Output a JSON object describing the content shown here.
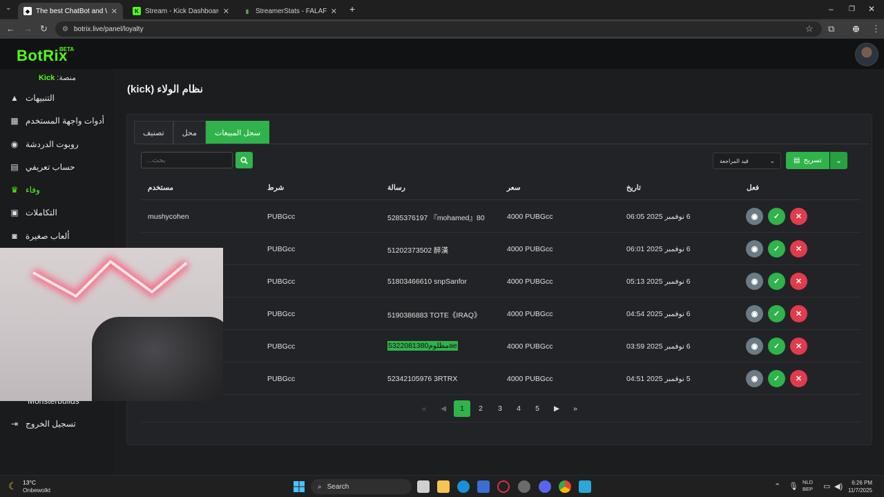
{
  "browser": {
    "tabs": [
      {
        "title": "The best ChatBot and Widgets",
        "active": true
      },
      {
        "title": "Stream - Kick Dashboard",
        "active": false
      },
      {
        "title": "StreamerStats - FALAFELCO Pro",
        "active": false
      }
    ],
    "url": "botrix.live/panel/loyalty"
  },
  "app": {
    "logo": "BotRix",
    "logo_badge": "BETA",
    "platform_label": "منصة:",
    "platform_value": "Kick",
    "accent": "#53fc18"
  },
  "sidebar": {
    "items": [
      {
        "label": "التنبيهات",
        "icon": "warning-icon",
        "active": false
      },
      {
        "label": "أدوات واجهة المستخدم",
        "icon": "widgets-icon",
        "active": false
      },
      {
        "label": "روبوت الدردشة",
        "icon": "robot-icon",
        "active": false
      },
      {
        "label": "حساب تعريفي",
        "icon": "id-card-icon",
        "active": false
      },
      {
        "label": "وفاء",
        "icon": "trophy-icon",
        "active": true
      },
      {
        "label": "التكاملات",
        "icon": "integrations-icon",
        "active": false
      },
      {
        "label": "ألعاب صغيرة",
        "icon": "gamepad-icon",
        "active": false
      }
    ],
    "hidden_item": "Monsterbuilds",
    "logout_label": "تسجيل الخروج"
  },
  "page": {
    "title": "نظام الولاء (kick)",
    "tabs": [
      "تصنيف",
      "محل",
      "سجل المبيعات"
    ],
    "active_tab": "سجل المبيعات",
    "search_placeholder": "بحث...",
    "filter_label": "قيد المراجعة",
    "export_label": "تسريح"
  },
  "table": {
    "headers": {
      "user": "مستخدم",
      "condition": "شرط",
      "message": "رسالة",
      "price": "سعر",
      "date": "تاريخ",
      "action": "فعل"
    },
    "rows": [
      {
        "user": "mushycohen",
        "condition": "PUBGcc",
        "message": "5285376197 『mohamed』80",
        "price": "4000 PUBGcc",
        "date": "6 نوفمبر 2025 06:05"
      },
      {
        "user": "",
        "condition": "PUBGcc",
        "message": "51202373502 醉漢",
        "price": "4000 PUBGcc",
        "date": "6 نوفمبر 2025 06:01"
      },
      {
        "user": "",
        "condition": "PUBGcc",
        "message": "51803466610 snpSanfor",
        "price": "4000 PUBGcc",
        "date": "6 نوفمبر 2025 05:13"
      },
      {
        "user": "",
        "condition": "PUBGcc",
        "message": "5190386883 TOTE《IRAQ》",
        "price": "4000 PUBGcc",
        "date": "6 نوفمبر 2025 04:54"
      },
      {
        "user": "",
        "condition": "PUBGcc",
        "message": "5322081380مظلومae",
        "price": "4000 PUBGcc",
        "date": "6 نوفمبر 2025 03:59",
        "highlighted": true
      },
      {
        "user": "",
        "condition": "PUBGcc",
        "message": "52342105976 3RTRX",
        "price": "4000 PUBGcc",
        "date": "5 نوفمبر 2025 04:51"
      }
    ]
  },
  "pagination": {
    "pages": [
      "1",
      "2",
      "3",
      "4",
      "5"
    ],
    "current": "1"
  },
  "taskbar": {
    "weather_temp": "13°C",
    "weather_cond": "Onbewolkt",
    "search_label": "Search",
    "lang_top": "NLD",
    "lang_bottom": "BEP",
    "time": "6:26 PM",
    "date": "11/7/2025"
  }
}
